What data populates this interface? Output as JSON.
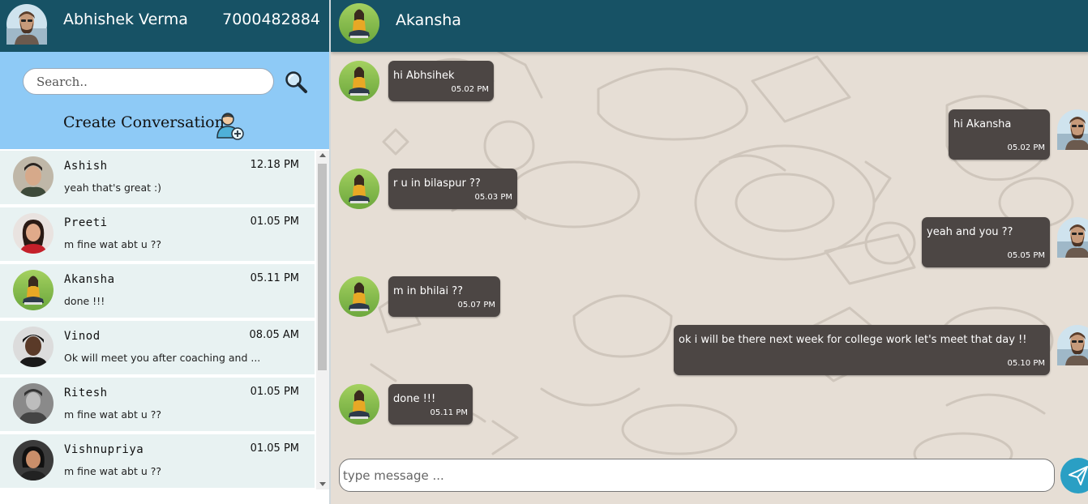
{
  "user": {
    "name": "Abhishek Verma",
    "phone": "7000482884",
    "avatar": "user-avatar-icon"
  },
  "search": {
    "placeholder": "Search..",
    "icon": "search-icon"
  },
  "create_conversation": {
    "label": "Create Conversation",
    "icon": "add-user-icon"
  },
  "conversations": [
    {
      "name": "Ashish",
      "time": "12.18 PM",
      "last_message": "yeah that's great :)",
      "avatar": "avatar-ashish"
    },
    {
      "name": "Preeti",
      "time": "01.05 PM",
      "last_message": "m fine wat abt u ??",
      "avatar": "avatar-preeti"
    },
    {
      "name": "Akansha",
      "time": "05.11 PM",
      "last_message": "done !!!",
      "avatar": "avatar-akansha"
    },
    {
      "name": "Vinod",
      "time": "08.05 AM",
      "last_message": "Ok will meet you after coaching and ...",
      "avatar": "avatar-vinod"
    },
    {
      "name": "Ritesh",
      "time": "01.05 PM",
      "last_message": "m fine wat abt u ??",
      "avatar": "avatar-ritesh"
    },
    {
      "name": "Vishnupriya",
      "time": "01.05 PM",
      "last_message": "m fine wat abt u ??",
      "avatar": "avatar-vishnupriya"
    }
  ],
  "chat": {
    "contact_name": "Akansha",
    "messages": [
      {
        "from": "them",
        "text": "hi Abhsihek",
        "time": "05.02 PM"
      },
      {
        "from": "me",
        "text": "hi Akansha",
        "time": "05.02 PM"
      },
      {
        "from": "them",
        "text": "r u in bilaspur ??",
        "time": "05.03 PM"
      },
      {
        "from": "me",
        "text": "yeah and you ??",
        "time": "05.05 PM"
      },
      {
        "from": "them",
        "text": "m in bhilai ??",
        "time": "05.07 PM"
      },
      {
        "from": "me",
        "text": "ok i will be there next week for college work let's meet that day !!",
        "time": "05.10 PM"
      },
      {
        "from": "them",
        "text": "done !!!",
        "time": "05.11 PM"
      }
    ],
    "input_placeholder": "type message ...",
    "send_icon": "send-icon"
  },
  "colors": {
    "header": "#175265",
    "search_panel": "#8ecaf6",
    "conversation_bg": "#e8f2f2",
    "chat_bg": "#e6ded5",
    "bubble": "#4c4644",
    "send_button": "#2a9fc4"
  }
}
